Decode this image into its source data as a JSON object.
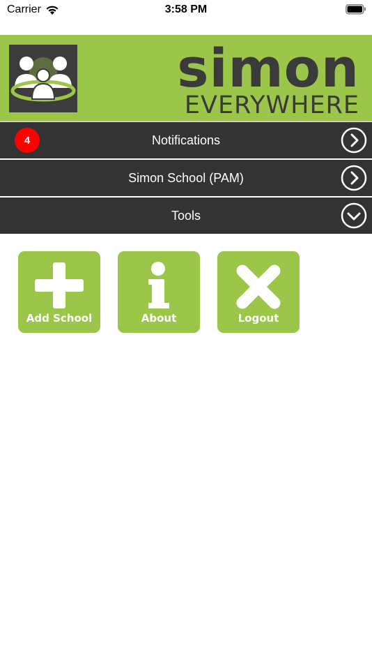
{
  "status_bar": {
    "carrier": "Carrier",
    "time": "3:58 PM"
  },
  "header": {
    "brand_name": "simon",
    "brand_sub": "EVERYWHERE"
  },
  "menu": [
    {
      "label": "Notifications",
      "badge": "4",
      "chevron": "chevron-right"
    },
    {
      "label": "Simon School (PAM)",
      "chevron": "chevron-right"
    },
    {
      "label": "Tools",
      "chevron": "chevron-down"
    }
  ],
  "tools": [
    {
      "label": "Add School",
      "icon": "plus-icon"
    },
    {
      "label": "About",
      "icon": "info-icon"
    },
    {
      "label": "Logout",
      "icon": "close-icon"
    }
  ],
  "colors": {
    "brand_green": "#9cc64a",
    "menu_dark": "#333333",
    "badge_red": "#ff0000"
  }
}
